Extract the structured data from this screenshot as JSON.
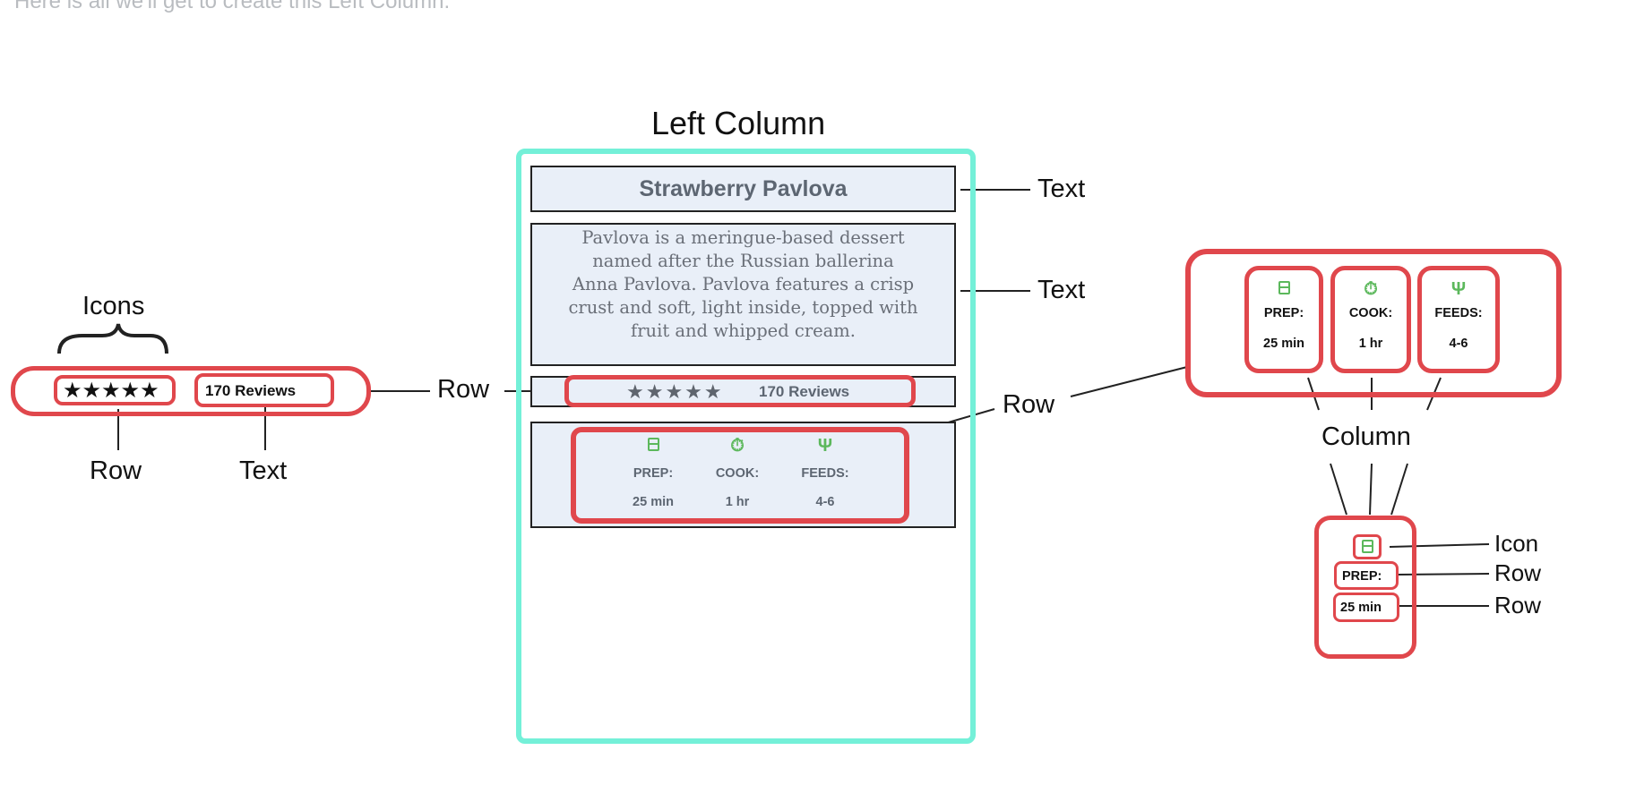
{
  "top_note": "Here is all we'll get to create this Left Column.",
  "recipe": {
    "title": "Strawberry Pavlova",
    "description": "Pavlova is a meringue-based dessert named after the Russian ballerina Anna Pavlova. Pavlova features a crisp crust and soft, light inside, topped with fruit and whipped cream.",
    "stars": "★★★★★",
    "reviews": "170 Reviews",
    "info": [
      {
        "label": "PREP:",
        "value": "25 min",
        "icon": "prep-timer-icon"
      },
      {
        "label": "COOK:",
        "value": "1 hr",
        "icon": "stopwatch-icon"
      },
      {
        "label": "FEEDS:",
        "value": "4-6",
        "icon": "fork-knife-icon"
      }
    ]
  },
  "annotations": {
    "left_column": "Left Column",
    "text": "Text",
    "row": "Row",
    "icons": "Icons",
    "column": "Column",
    "icon": "Icon"
  },
  "colors": {
    "container_outline": "#74f0d8",
    "highlight": "#e0474c",
    "icon_green": "#5cb85c",
    "panel_bg": "#e9eff8"
  }
}
